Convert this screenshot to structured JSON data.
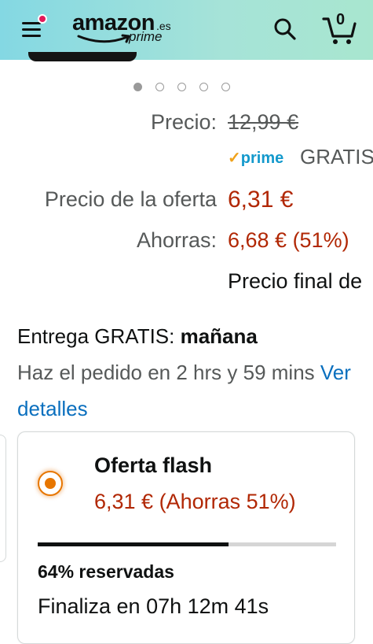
{
  "header": {
    "logo_word": "amazon",
    "logo_tld": ".es",
    "logo_sub": "prime",
    "cart_count": "0",
    "colors": {
      "gradient_start": "#84d8e3",
      "gradient_end": "#a8e6cf",
      "notification_dot": "#e3185a"
    }
  },
  "carousel": {
    "total": 5,
    "active": 1
  },
  "pricing": {
    "list_label": "Precio:",
    "list_price": "12,99 €",
    "prime_badge": "prime",
    "shipping": "GRATIS",
    "deal_label": "Precio de la oferta",
    "deal_price": "6,31 €",
    "savings_label": "Ahorras:",
    "savings_value": "6,68 € (51%)",
    "final_price_label": "Precio final de"
  },
  "delivery": {
    "prefix": "Entrega GRATIS: ",
    "day": "mañana",
    "order_within": "Haz el pedido en 2 hrs y 59 mins ",
    "details_link": "Ver detalles"
  },
  "flash_deal": {
    "title": "Oferta flash",
    "price_line": "6,31 € (Ahorras 51%)",
    "claimed_percent": 64,
    "claimed_text": "64% reservadas",
    "ends_text": "Finaliza en 07h 12m 41s"
  },
  "colors": {
    "price_red": "#b12704",
    "link_blue": "#0a6fbe",
    "prime_blue": "#1399cc",
    "radio_orange": "#e77600"
  }
}
